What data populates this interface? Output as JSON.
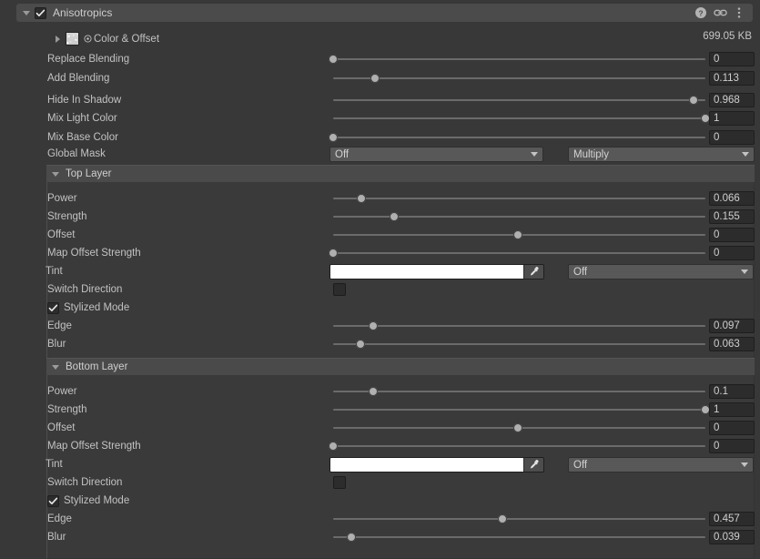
{
  "component": {
    "title": "Anisotropics",
    "enabled": true,
    "expanded": true,
    "memory_size": "699.05 KB",
    "icons": {
      "help": "help-icon",
      "link": "link-icon",
      "menu": "kebab-menu-icon"
    }
  },
  "texture_row": {
    "label": "Color & Offset",
    "expanded": false
  },
  "main_rows": [
    {
      "label": "Replace Blending",
      "value": "0",
      "fraction": 0.0
    },
    {
      "label": "Add Blending",
      "value": "0.113",
      "fraction": 0.113
    },
    {
      "label": "Hide In Shadow",
      "value": "0.968",
      "fraction": 0.968
    },
    {
      "label": "Mix Light Color",
      "value": "1",
      "fraction": 1.0
    },
    {
      "label": "Mix Base Color",
      "value": "0",
      "fraction": 0.0
    }
  ],
  "global_mask": {
    "label": "Global Mask",
    "mode_value": "Off",
    "blend_value": "Multiply"
  },
  "layers": [
    {
      "title": "Top Layer",
      "expanded": true,
      "sliders": [
        {
          "label": "Power",
          "value": "0.066",
          "fraction": 0.075
        },
        {
          "label": "Strength",
          "value": "0.155",
          "fraction": 0.165
        },
        {
          "label": "Offset",
          "value": "0",
          "fraction": 0.497
        },
        {
          "label": "Map Offset Strength",
          "value": "0",
          "fraction": 0.0
        }
      ],
      "tint": {
        "label": "Tint",
        "color": "#ffffff",
        "mode_value": "Off"
      },
      "switch_direction": {
        "label": "Switch Direction",
        "checked": false
      },
      "stylized_mode": {
        "label": "Stylized Mode",
        "checked": true
      },
      "stylized_sliders": [
        {
          "label": "Edge",
          "value": "0.097",
          "fraction": 0.107
        },
        {
          "label": "Blur",
          "value": "0.063",
          "fraction": 0.073
        }
      ]
    },
    {
      "title": "Bottom Layer",
      "expanded": true,
      "sliders": [
        {
          "label": "Power",
          "value": "0.1",
          "fraction": 0.108
        },
        {
          "label": "Strength",
          "value": "1",
          "fraction": 1.0
        },
        {
          "label": "Offset",
          "value": "0",
          "fraction": 0.497
        },
        {
          "label": "Map Offset Strength",
          "value": "0",
          "fraction": 0.0
        }
      ],
      "tint": {
        "label": "Tint",
        "color": "#ffffff",
        "mode_value": "Off"
      },
      "switch_direction": {
        "label": "Switch Direction",
        "checked": false
      },
      "stylized_mode": {
        "label": "Stylized Mode",
        "checked": true
      },
      "stylized_sliders": [
        {
          "label": "Edge",
          "value": "0.457",
          "fraction": 0.455
        },
        {
          "label": "Blur",
          "value": "0.039",
          "fraction": 0.048
        }
      ]
    }
  ],
  "theme": {
    "background": "#383838",
    "header_bar": "#4b4b4b",
    "group_header": "#4a4a4a",
    "group_body": "#3a3a3a",
    "field_bg": "#2c2c2c",
    "popup_bg": "#585858",
    "text": "#c2c2c2",
    "slider_track": "#6b6b6b",
    "slider_thumb": "#b0b0b0"
  }
}
